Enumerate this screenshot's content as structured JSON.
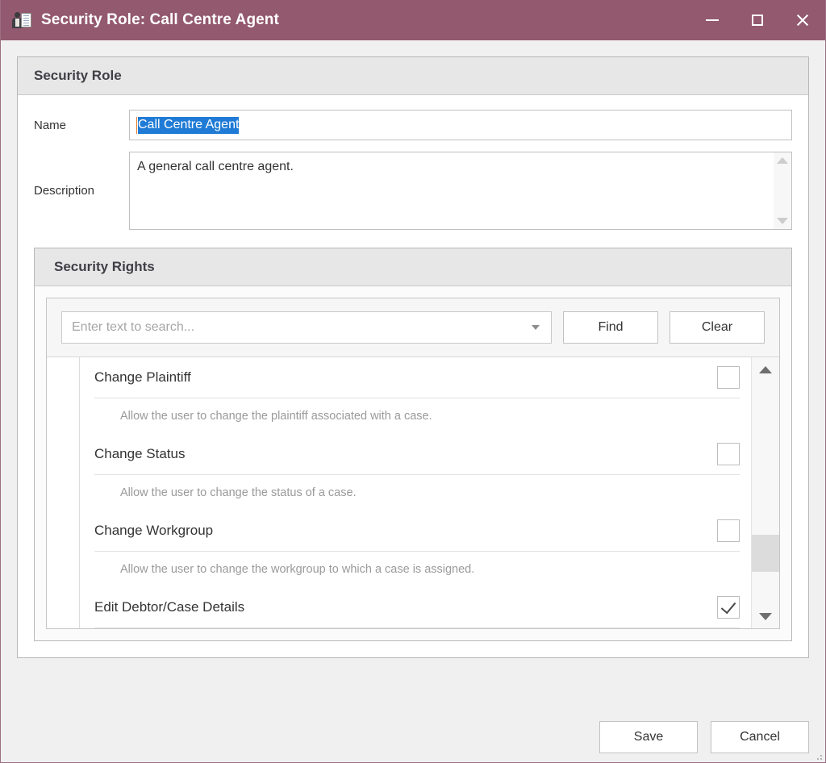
{
  "window": {
    "title": "Security Role: Call Centre Agent",
    "icon": "security-role-icon",
    "minimize_label": "Minimize",
    "maximize_label": "Maximize",
    "close_label": "Close"
  },
  "security_role_group": {
    "header": "Security Role",
    "name_label": "Name",
    "name_value": "Call Centre Agent",
    "name_selected": true,
    "description_label": "Description",
    "description_value": "A general call centre agent."
  },
  "security_rights_group": {
    "header": "Security Rights",
    "search": {
      "placeholder": "Enter text to search...",
      "value": "",
      "find_label": "Find",
      "clear_label": "Clear"
    },
    "items": [
      {
        "title": "Change Plaintiff",
        "description": "Allow the user to change the plaintiff associated with a case.",
        "checked": false
      },
      {
        "title": "Change Status",
        "description": "Allow the user to change the status of a case.",
        "checked": false
      },
      {
        "title": "Change Workgroup",
        "description": "Allow the user to change the workgroup to which a case is assigned.",
        "checked": false
      },
      {
        "title": "Edit Debtor/Case Details",
        "description": "",
        "checked": true
      }
    ]
  },
  "footer": {
    "save_label": "Save",
    "cancel_label": "Cancel"
  },
  "colors": {
    "titlebar": "#93596e",
    "title_text": "#ffffff",
    "selection": "#1f7bd6",
    "caret": "#e07b2a",
    "group_header_bg": "#e7e7e7",
    "muted_text": "#9a9a9a"
  }
}
